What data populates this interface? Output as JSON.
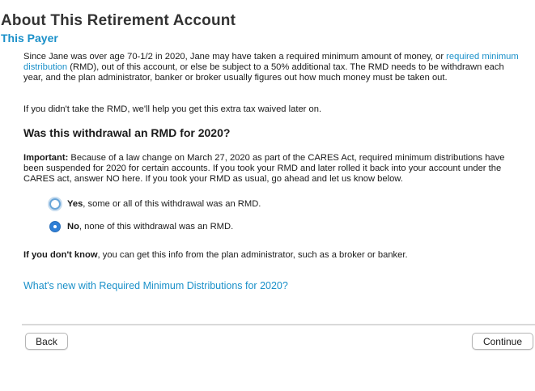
{
  "header": {
    "title": "About This Retirement Account",
    "subtitle": "This Payer"
  },
  "intro": {
    "text_before_link": "Since Jane was over age 70-1/2 in 2020, Jane may have taken a required minimum amount of money, or ",
    "link": "required minimum distribution",
    "text_after_link": " (RMD), out of this account, or else be subject to a 50% additional tax. The RMD needs to be withdrawn each year, and the plan administrator, banker or broker usually figures out how much money must be taken out.",
    "waive_note": "If you didn't take the RMD, we'll help you get this extra tax waived later on."
  },
  "question": "Was this withdrawal an RMD for 2020?",
  "important": {
    "label": "Important:",
    "text": " Because of a law change on March 27, 2020 as part of the CARES Act, required minimum distributions have been suspended for 2020 for certain accounts. If you took your RMD and later rolled it back into your account under the CARES act, answer NO here. If you took your RMD as usual, go ahead and let us know below."
  },
  "options": {
    "yes": {
      "bold": "Yes",
      "rest": ", some or all of this withdrawal was an RMD.",
      "selected": false
    },
    "no": {
      "bold": "No",
      "rest": ", none of this withdrawal was an RMD.",
      "selected": true
    }
  },
  "dont_know": {
    "bold": "If you don't know",
    "rest": ", you can get this info from the plan administrator, such as a broker or banker."
  },
  "whats_new_link": "What's new with Required Minimum Distributions for 2020?",
  "footer": {
    "back_label": "Back",
    "continue_label": "Continue"
  },
  "colors": {
    "link": "#1a90c9",
    "radio_selected": "#2f7fd6"
  }
}
